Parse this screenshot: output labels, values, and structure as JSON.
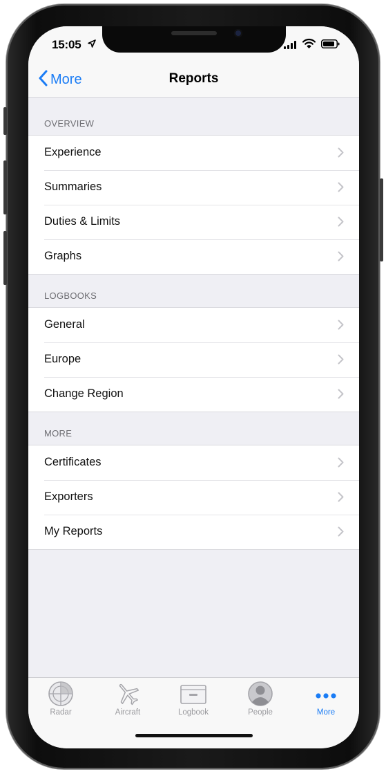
{
  "status": {
    "time": "15:05"
  },
  "nav": {
    "back_label": "More",
    "title": "Reports"
  },
  "sections": [
    {
      "header": "OVERVIEW",
      "items": [
        "Experience",
        "Summaries",
        "Duties & Limits",
        "Graphs"
      ]
    },
    {
      "header": "LOGBOOKS",
      "items": [
        "General",
        "Europe",
        "Change Region"
      ]
    },
    {
      "header": "MORE",
      "items": [
        "Certificates",
        "Exporters",
        "My Reports"
      ]
    }
  ],
  "tabs": [
    {
      "label": "Radar",
      "icon": "radar-icon",
      "active": false
    },
    {
      "label": "Aircraft",
      "icon": "airplane-icon",
      "active": false
    },
    {
      "label": "Logbook",
      "icon": "logbook-icon",
      "active": false
    },
    {
      "label": "People",
      "icon": "person-icon",
      "active": false
    },
    {
      "label": "More",
      "icon": "ellipsis-icon",
      "active": true
    }
  ],
  "colors": {
    "accent": "#1a7cf5",
    "background": "#efeff4",
    "inactive_tab": "#9a9a9e"
  }
}
